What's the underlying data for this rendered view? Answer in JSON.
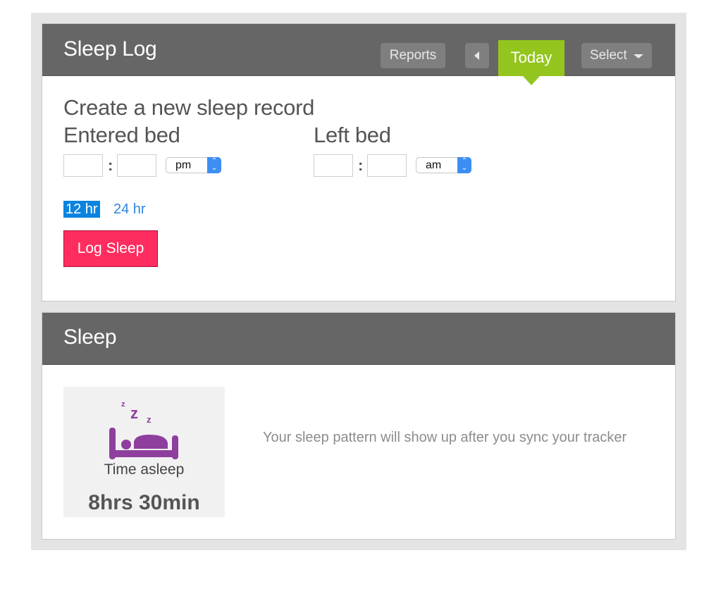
{
  "sleep_log": {
    "title": "Sleep Log",
    "reports_label": "Reports",
    "today_label": "Today",
    "select_label": "Select",
    "create_heading": "Create a new sleep record",
    "entered_bed": {
      "label": "Entered bed",
      "hour": "",
      "minute": "",
      "separator": ":",
      "period": "pm"
    },
    "left_bed": {
      "label": "Left bed",
      "hour": "",
      "minute": "",
      "separator": ":",
      "period": "am"
    },
    "format_12": "12 hr",
    "format_24": "24 hr",
    "active_format": "12 hr",
    "log_button": "Log Sleep"
  },
  "sleep": {
    "title": "Sleep",
    "time_asleep_label": "Time asleep",
    "time_asleep_value": "8hrs 30min",
    "icon": "sleeping-bed-icon",
    "sync_message": "Your sleep pattern will show up after you sync your tracker"
  },
  "colors": {
    "header_bg": "#666666",
    "today_accent": "#94c51e",
    "log_button": "#ff2d5f",
    "format_active": "#0a84e0",
    "icon_purple": "#8e3f9e"
  }
}
